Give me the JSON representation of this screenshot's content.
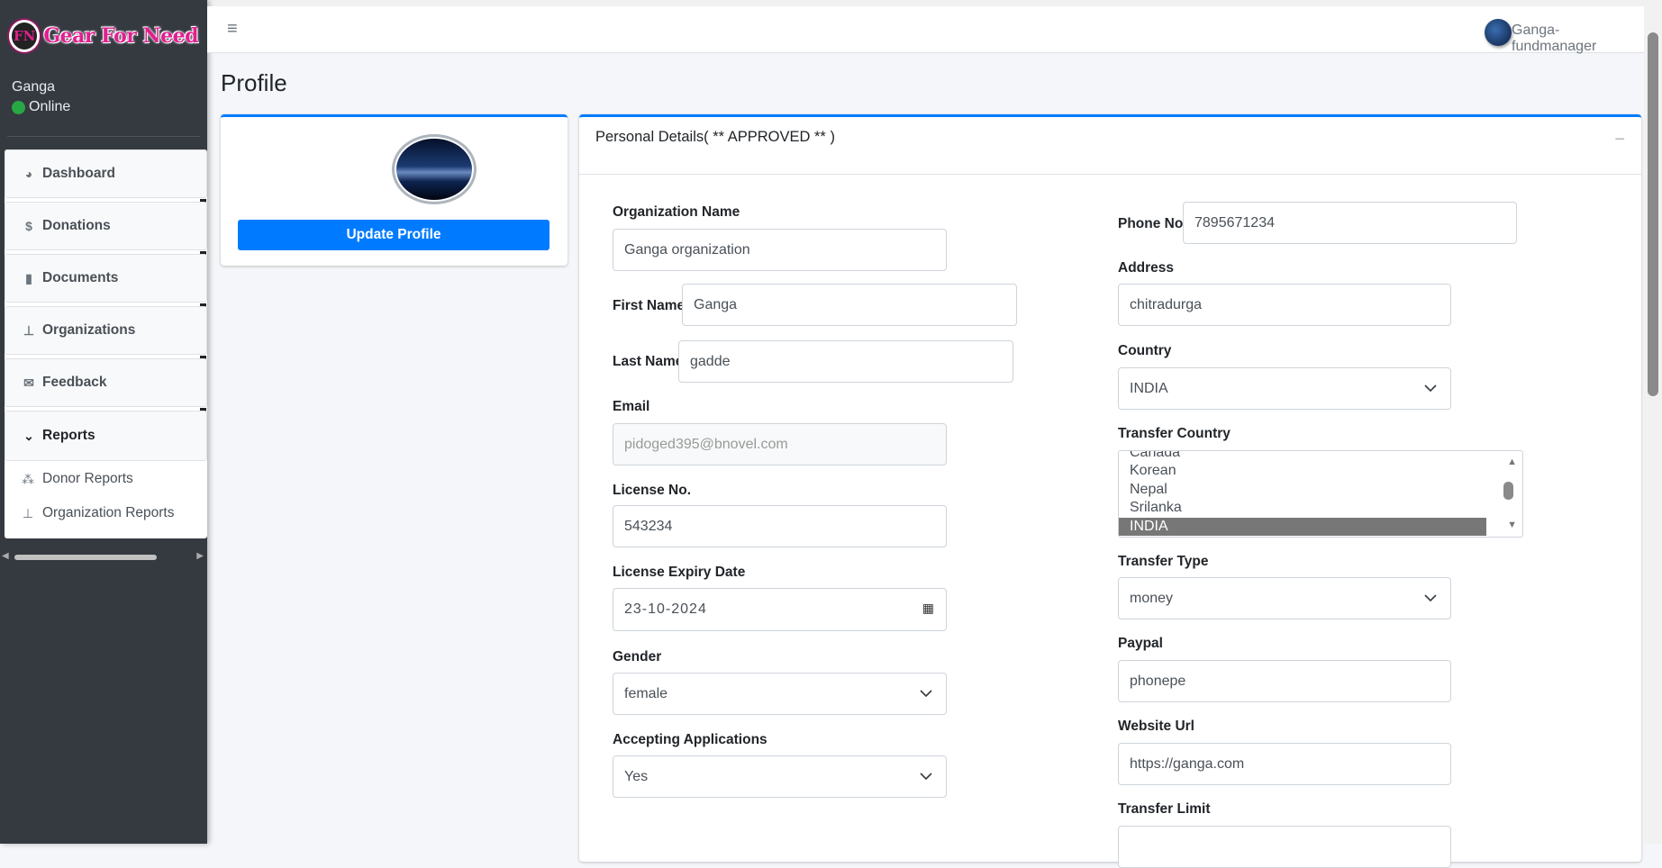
{
  "brand": {
    "name": "Gear For Need",
    "logo_initials": "FN"
  },
  "sidebar": {
    "user": {
      "name": "Ganga",
      "status": "Online",
      "status_color": "#28a745"
    },
    "items": [
      {
        "label": "Dashboard",
        "icon": "chart-pie-icon"
      },
      {
        "label": "Donations",
        "icon": "donate-icon"
      },
      {
        "label": "Documents",
        "icon": "file-icon"
      },
      {
        "label": "Organizations",
        "icon": "sitemap-icon"
      },
      {
        "label": "Feedback",
        "icon": "envelope-icon"
      },
      {
        "label": "Reports",
        "icon": "chevron-down-icon",
        "expanded": true
      }
    ],
    "subitems": [
      {
        "label": "Donor Reports",
        "icon": "users-icon"
      },
      {
        "label": "Organization Reports",
        "icon": "sitemap-icon"
      }
    ]
  },
  "topbar": {
    "username": "Ganga-fundmanager",
    "menu_icon": "hamburger-icon"
  },
  "page": {
    "title": "Profile"
  },
  "profile_card": {
    "update_button": "Update Profile"
  },
  "details": {
    "title": "Personal Details( ** APPROVED ** )",
    "fields": {
      "org_name": {
        "label": "Organization Name",
        "value": "Ganga organization"
      },
      "first_name": {
        "label": "First Name",
        "value": "Ganga"
      },
      "last_name": {
        "label": "Last Name",
        "value": "gadde"
      },
      "email": {
        "label": "Email",
        "value": "pidoged395@bnovel.com"
      },
      "license_no": {
        "label": "License No.",
        "value": "543234"
      },
      "license_expiry": {
        "label": "License Expiry Date",
        "value": "23-10-2024"
      },
      "gender": {
        "label": "Gender",
        "value": "female"
      },
      "accepting": {
        "label": "Accepting Applications",
        "value": "Yes"
      },
      "phone": {
        "label": "Phone No.",
        "value": "7895671234"
      },
      "address": {
        "label": "Address",
        "value": "chitradurga"
      },
      "country": {
        "label": "Country",
        "value": "INDIA"
      },
      "transfer_country": {
        "label": "Transfer Country",
        "options": [
          "Canada",
          "Korean",
          "Nepal",
          "Srilanka",
          "INDIA"
        ],
        "selected": "INDIA"
      },
      "transfer_type": {
        "label": "Transfer Type",
        "value": "money"
      },
      "paypal": {
        "label": "Paypal",
        "value": "phonepe"
      },
      "website": {
        "label": "Website Url",
        "value": "https://ganga.com"
      },
      "transfer_limit": {
        "label": "Transfer Limit",
        "value": ""
      }
    }
  },
  "colors": {
    "primary": "#007bff",
    "sidebar_bg": "#343a40",
    "selected_option": "#777777"
  }
}
